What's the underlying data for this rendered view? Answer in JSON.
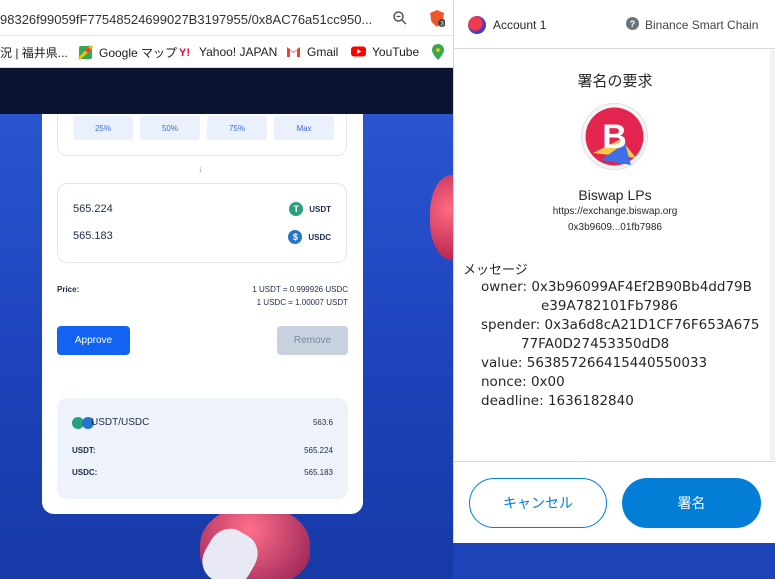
{
  "browser": {
    "url": "98326f99059fF77548524699027B3197955/0x8AC76a51cc950...",
    "brave_badge": "3",
    "bookmarks": [
      {
        "label": "況 | 福井県...",
        "icon": "folder-icon"
      },
      {
        "label": "Google マップ",
        "icon": "google-maps-icon"
      },
      {
        "label": "Yahoo! JAPAN",
        "icon": "yahoo-icon"
      },
      {
        "label": "Gmail",
        "icon": "gmail-icon"
      },
      {
        "label": "YouTube",
        "icon": "youtube-icon"
      }
    ]
  },
  "dapp": {
    "percent_buttons": [
      "25%",
      "50%",
      "75%",
      "Max"
    ],
    "arrow": "↓",
    "token_a": {
      "amount": "565.224",
      "symbol": "USDT",
      "color": "#26a17b"
    },
    "token_b": {
      "amount": "565.183",
      "symbol": "USDC",
      "color": "#2775ca"
    },
    "price_label": "Price:",
    "price_line1": "1 USDT = 0.999926 USDC",
    "price_line2": "1 USDC = 1.00007 USDT",
    "approve_label": "Approve",
    "remove_label": "Remove",
    "pool": {
      "pair": "USDT/USDC",
      "pair_value": "563.6",
      "rows": [
        {
          "label": "USDT:",
          "value": "565.224"
        },
        {
          "label": "USDC:",
          "value": "565.183"
        }
      ]
    }
  },
  "metamask": {
    "account": "Account 1",
    "network": "Binance Smart Chain",
    "title": "署名の要求",
    "site_name": "Biswap LPs",
    "site_url": "https://exchange.biswap.org",
    "site_address": "0x3b9609...01fb7986",
    "message_label": "メッセージ",
    "message": [
      {
        "key": "owner:",
        "value": "0x3b96099AF4Ef2B90Bb4dd79B",
        "value2": "e39A782101Fb7986"
      },
      {
        "key": "spender:",
        "value": "0x3a6d8cA21D1CF76F653A675",
        "value2": "77FA0D27453350dD8"
      },
      {
        "key": "value:",
        "value": "563857266415440550033",
        "value2": ""
      },
      {
        "key": "nonce:",
        "value": "0x00",
        "value2": ""
      },
      {
        "key": "deadline:",
        "value": "1636182840",
        "value2": ""
      }
    ],
    "cancel_label": "キャンセル",
    "sign_label": "署名",
    "accent_color": "#037dd6"
  }
}
